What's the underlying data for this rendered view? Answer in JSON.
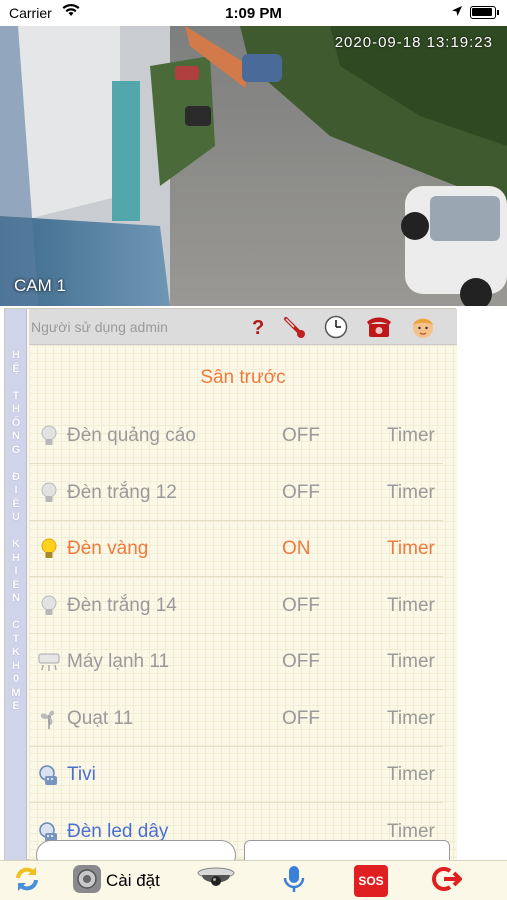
{
  "status": {
    "carrier": "Carrier",
    "time": "1:09 PM"
  },
  "camera": {
    "timestamp": "2020-09-18 13:19:23",
    "label": "CAM 1"
  },
  "userbar": {
    "user": "Người sử dụng admin",
    "icons": [
      "help-icon",
      "thermometer-icon",
      "clock-icon",
      "phone-icon",
      "user-face-icon"
    ]
  },
  "sidebar": {
    "label": "HỆ THỐNG ĐIỀU KHIỂN CTK H0ME"
  },
  "section": {
    "title": "Sân trước"
  },
  "devices": [
    {
      "name": "Đèn quảng cáo",
      "state": "OFF",
      "timer": "Timer",
      "icon": "bulb-icon"
    },
    {
      "name": "Đèn trắng 12",
      "state": "OFF",
      "timer": "Timer",
      "icon": "bulb-icon"
    },
    {
      "name": "Đèn vàng",
      "state": "ON",
      "timer": "Timer",
      "icon": "bulb-on-icon"
    },
    {
      "name": "Đèn trắng 14",
      "state": "OFF",
      "timer": "Timer",
      "icon": "bulb-icon"
    },
    {
      "name": "Máy lạnh 11",
      "state": "OFF",
      "timer": "Timer",
      "icon": "air-conditioner-icon"
    },
    {
      "name": "Quạt 11",
      "state": "OFF",
      "timer": "Timer",
      "icon": "fan-icon"
    },
    {
      "name": "Tivi",
      "state": "",
      "timer": "Timer",
      "icon": "remote-icon"
    },
    {
      "name": "Đèn led dây",
      "state": "",
      "timer": "Timer",
      "icon": "remote-icon"
    }
  ],
  "toolbar": {
    "settings_label": "Cài đặt",
    "sos_label": "SOS",
    "icons": [
      "refresh-icon",
      "settings-gear-icon",
      "security-camera-icon",
      "microphone-icon",
      "sos-icon",
      "logout-icon"
    ]
  },
  "colors": {
    "accent_on": "#f07a3c",
    "off_text": "#9a9a9a",
    "link_blue": "#4a6fd0",
    "panel_bg": "#fbf8e8",
    "sidebar_bg": "#d0d4ea"
  }
}
